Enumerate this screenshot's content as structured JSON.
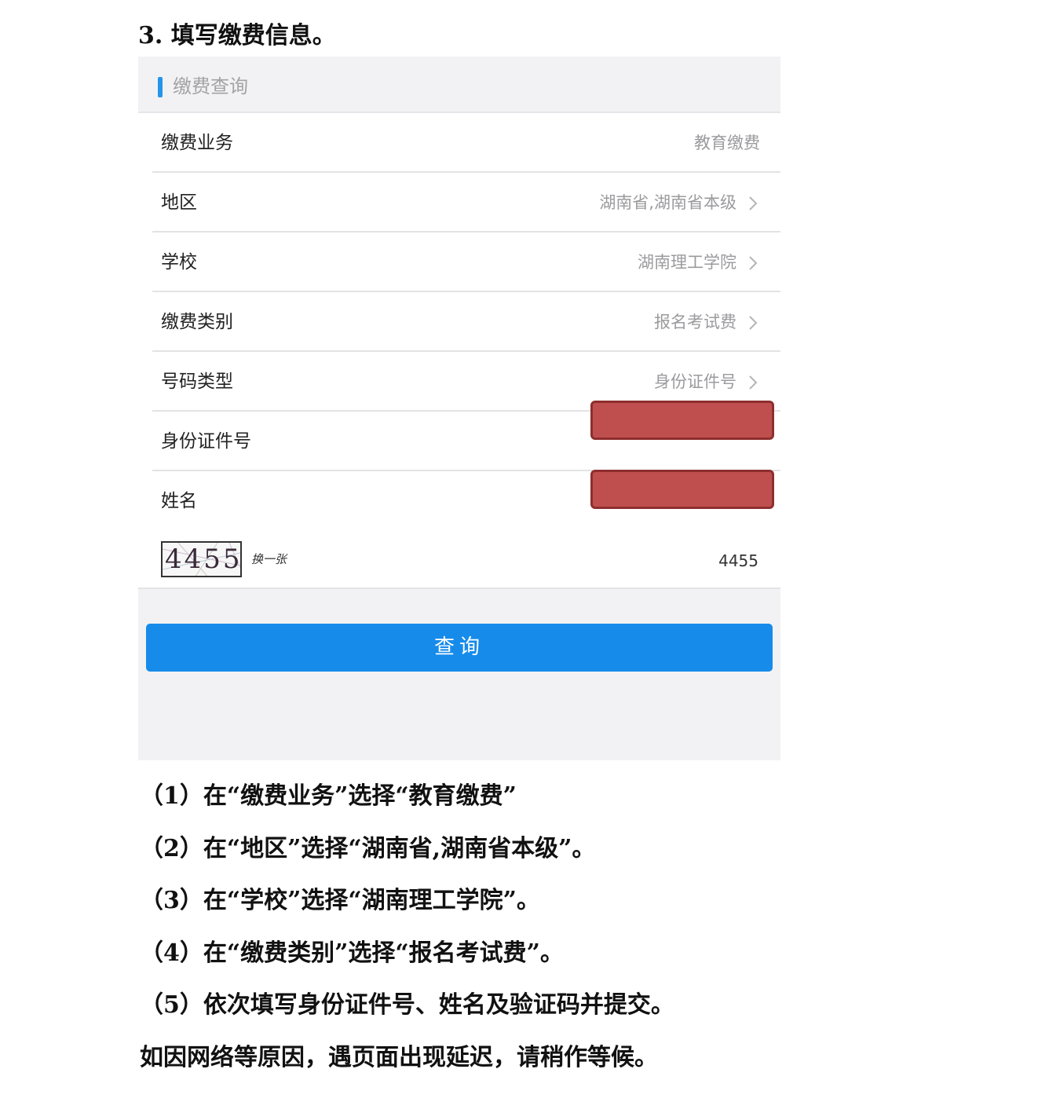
{
  "heading": "3. 填写缴费信息。",
  "form": {
    "header_title": "缴费查询",
    "accent_color": "#2494ec",
    "rows": [
      {
        "label": "缴费业务",
        "value": "教育缴费"
      },
      {
        "label": "地区",
        "value": "湖南省,湖南省本级"
      },
      {
        "label": "学校",
        "value": "湖南理工学院"
      },
      {
        "label": "缴费类别",
        "value": "报名考试费"
      },
      {
        "label": "号码类型",
        "value": "身份证件号"
      },
      {
        "label": "身份证件号",
        "value": ""
      },
      {
        "label": "姓名",
        "value": ""
      }
    ],
    "captcha": {
      "image_text": "4455",
      "refresh_label": "换一张",
      "input_value": "4455"
    },
    "submit_label": "查询",
    "submit_color": "#168bea",
    "redaction_color": "#bf4f4f"
  },
  "instructions": [
    "（1）在“缴费业务”选择“教育缴费”",
    "（2）在“地区”选择“湖南省,湖南省本级”。",
    "（3）在“学校”选择“湖南理工学院”。",
    "（4）在“缴费类别”选择“报名考试费”。",
    "（5）依次填写身份证件号、姓名及验证码并提交。"
  ],
  "footer_note": "如因网络等原因，遇页面出现延迟，请稍作等候。"
}
